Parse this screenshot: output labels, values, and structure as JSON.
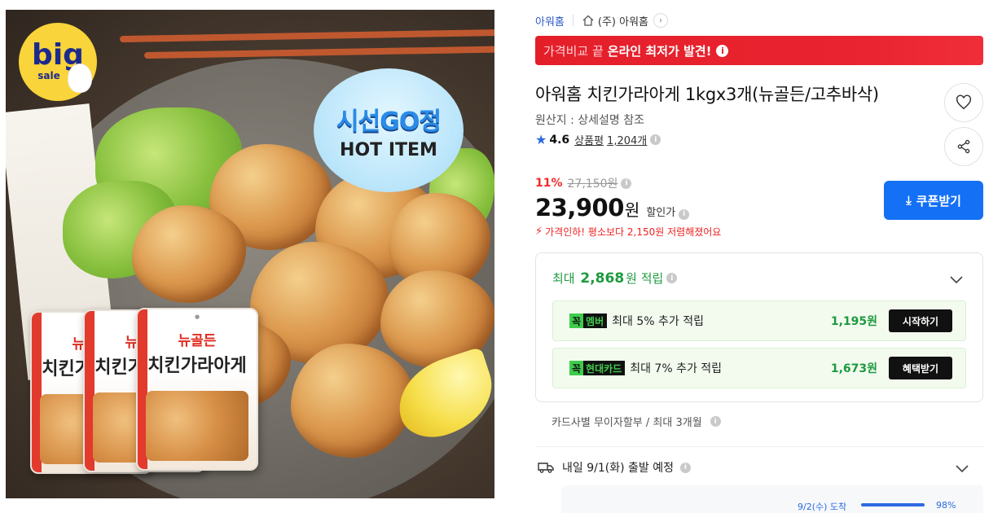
{
  "image": {
    "badge_big": "big",
    "badge_sale": "sale",
    "hot_title": "시선GO정",
    "hot_subtitle": "HOT ITEM",
    "bag_line1": "뉴골든",
    "bag_line2": "치킨가라아게"
  },
  "seller": {
    "brand": "아워홈",
    "store": "(주) 아워홈"
  },
  "promo": {
    "lead": "가격비교 끝",
    "highlight": "온라인 최저가 발견!"
  },
  "product": {
    "title": "아워홈 치킨가라아게 1kgx3개(뉴골든/고추바삭)",
    "origin": "원산지 : 상세설명 참조",
    "rating": "4.6",
    "review_label": "상품평",
    "review_count": "1,204개"
  },
  "price": {
    "discount_pct": "11%",
    "original": "27,150원",
    "sale": "23,900",
    "sale_unit": "원",
    "sale_label": "할인가",
    "drop_text": "가격인하! 평소보다 2,150원 저렴해졌어요"
  },
  "coupon": {
    "label": "쿠폰받기"
  },
  "reward": {
    "head_prefix": "최대",
    "head_amount": "2,868",
    "head_suffix": "원 적립",
    "rows": [
      {
        "tag_prefix": "꼭",
        "tag_name": "멤버",
        "text": "최대 5% 추가 적립",
        "amount": "1,195원",
        "button": "시작하기"
      },
      {
        "tag_prefix": "꼭",
        "tag_name": "현대카드",
        "text": "최대 7% 추가 적립",
        "amount": "1,673원",
        "button": "혜택받기"
      }
    ]
  },
  "installment": "카드사별 무이자할부 / 최대 3개월",
  "shipping": {
    "text": "내일 9/1(화) 출발 예정",
    "eta_day": "9/2(수) 도착",
    "eta_pct_label": "98%",
    "eta_fraction": 0.98
  },
  "colors": {
    "accent": "#1470f5",
    "promo_red": "#e41f2a",
    "reward_green": "#1d9a3f",
    "discount_red": "#ef2b2b"
  }
}
